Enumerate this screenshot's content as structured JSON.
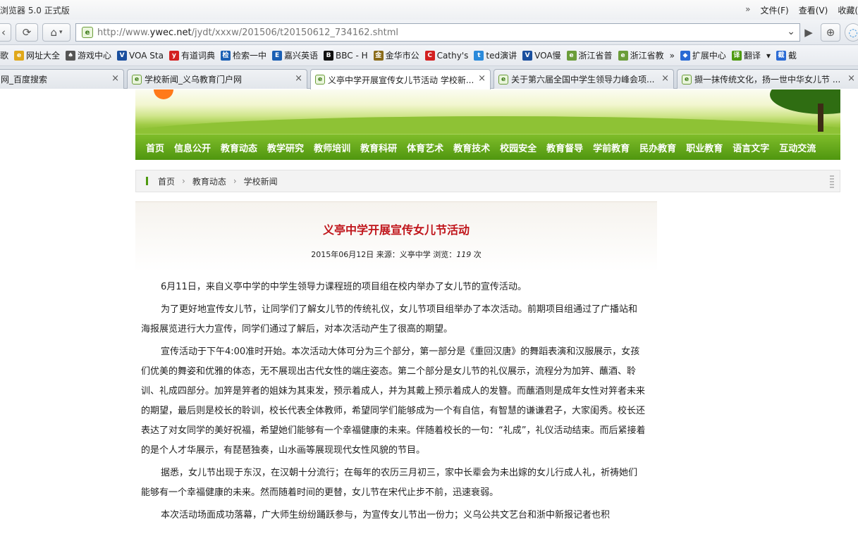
{
  "browser": {
    "title": "浏览器 5.0 正式版",
    "menu": {
      "more": "»",
      "file": "文件(F)",
      "view": "查看(V)",
      "favorites": "收藏("
    },
    "url": {
      "prefix": "http://www.",
      "domain": "ywec.net",
      "path": "/jydt/xxxw/201506/t20150612_734162.shtml"
    },
    "bookmarks": [
      {
        "label": "歌",
        "icon": "",
        "color": "#888"
      },
      {
        "label": "网址大全",
        "icon": "e",
        "color": "#e0a81a"
      },
      {
        "label": "游戏中心",
        "icon": "♠",
        "color": "#555"
      },
      {
        "label": "VOA Sta",
        "icon": "V",
        "color": "#1a4f9e"
      },
      {
        "label": "有道词典",
        "icon": "y",
        "color": "#d32020"
      },
      {
        "label": "检索一中",
        "icon": "检",
        "color": "#1a5fb4"
      },
      {
        "label": "嘉兴英语",
        "icon": "E",
        "color": "#1a5fb4"
      },
      {
        "label": "BBC - H",
        "icon": "B",
        "color": "#111"
      },
      {
        "label": "金华市公",
        "icon": "金",
        "color": "#8a6b1a"
      },
      {
        "label": "Cathy's",
        "icon": "C",
        "color": "#d32020"
      },
      {
        "label": "ted演讲",
        "icon": "t",
        "color": "#2a8adb"
      },
      {
        "label": "VOA慢",
        "icon": "V",
        "color": "#1a4f9e"
      },
      {
        "label": "浙江省普",
        "icon": "e",
        "color": "#6b9d3a"
      },
      {
        "label": "浙江省教",
        "icon": "e",
        "color": "#6b9d3a"
      },
      {
        "label": "»",
        "icon": "",
        "color": "#888"
      },
      {
        "label": "扩展中心",
        "icon": "◆",
        "color": "#2a6ad4"
      },
      {
        "label": "翻译",
        "icon": "译",
        "color": "#4e9a10"
      },
      {
        "label": "▾",
        "icon": "",
        "color": "#888"
      },
      {
        "label": "截",
        "icon": "截",
        "color": "#2a6ad4"
      }
    ],
    "tabs": [
      {
        "title": "网_百度搜索",
        "close": "×"
      },
      {
        "title": "学校新闻_义乌教育门户网",
        "close": "×"
      },
      {
        "title": "义亭中学开展宣传女儿节活动 学校新...",
        "close": "×"
      },
      {
        "title": "关于第六届全国中学生领导力峰会项...",
        "close": "×"
      },
      {
        "title": "撷一抹传统文化，扬一世中华女儿节 ...",
        "close": "×"
      }
    ]
  },
  "site": {
    "nav": [
      "首页",
      "信息公开",
      "教育动态",
      "教学研究",
      "教师培训",
      "教育科研",
      "体育艺术",
      "教育技术",
      "校园安全",
      "教育督导",
      "学前教育",
      "民办教育",
      "职业教育",
      "语言文字",
      "互动交流"
    ],
    "breadcrumb": [
      "首页",
      "教育动态",
      "学校新闻"
    ]
  },
  "article": {
    "title": "义亭中学开展宣传女儿节活动",
    "meta": {
      "date": "2015年06月12日",
      "source": "来源：义亭中学",
      "views_label": "浏览：",
      "views": "119",
      "unit": "次"
    },
    "paragraphs": [
      "6月11日，来自义亭中学的中学生领导力课程班的项目组在校内举办了女儿节的宣传活动。",
      "为了更好地宣传女儿节，让同学们了解女儿节的传统礼仪，女儿节项目组举办了本次活动。前期项目组通过了广播站和海报展览进行大力宣传，同学们通过了解后，对本次活动产生了很高的期望。",
      "宣传活动于下午4:00准时开始。本次活动大体可分为三个部分，第一部分是《重回汉唐》的舞蹈表演和汉服展示，女孩们优美的舞姿和优雅的体态，无不展现出古代女性的端庄姿态。第二个部分是女儿节的礼仪展示，流程分为加笄、蘸酒、聆训、礼成四部分。加笄是笄者的姐妹为其束发，预示着成人，并为其戴上预示着成人的发簪。而蘸酒则是成年女性对笄者未来的期望，最后则是校长的聆训，校长代表全体教师，希望同学们能够成为一个有自信，有智慧的谦谦君子，大家闺秀。校长还表达了对女同学的美好祝福，希望她们能够有一个幸福健康的未来。伴随着校长的一句：“礼成”，礼仪活动结束。而后紧接着的是个人才华展示，有琵琶独奏，山水画等展现现代女性风貌的节目。",
      "据悉，女儿节出现于东汉，在汉朝十分流行；在每年的农历三月初三，家中长辈会为未出嫁的女儿行成人礼，祈祷她们能够有一个幸福健康的未来。然而随着时间的更替，女儿节在宋代止步不前，迅速衰弱。",
      "本次活动场面成功落幕，广大师生纷纷踊跃参与，为宣传女儿节出一份力；义乌公共文艺台和浙中新报记者也积"
    ]
  }
}
